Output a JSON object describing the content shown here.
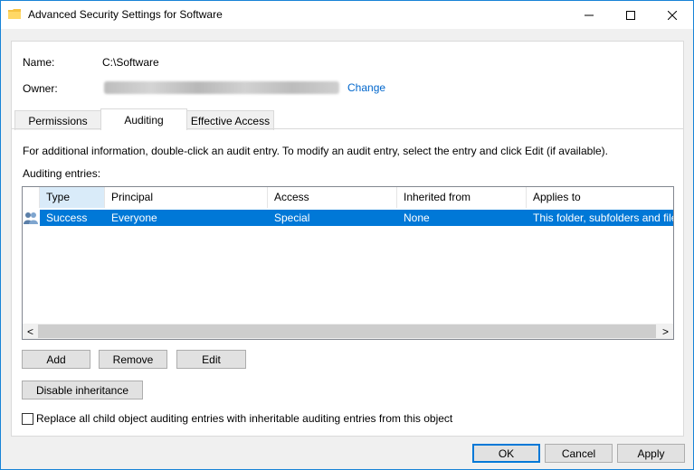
{
  "window": {
    "title": "Advanced Security Settings for Software",
    "icon": "folder-icon",
    "controls": [
      "minimize-icon",
      "maximize-icon",
      "close-icon"
    ]
  },
  "details": {
    "name_label": "Name:",
    "name_value": "C:\\Software",
    "owner_label": "Owner:",
    "change_link": "Change"
  },
  "tabs": [
    {
      "label": "Permissions",
      "active": false
    },
    {
      "label": "Auditing",
      "active": true
    },
    {
      "label": "Effective Access",
      "active": false
    }
  ],
  "auditing": {
    "info_text": "For additional information, double-click an audit entry. To modify an audit entry, select the entry and click Edit (if available).",
    "entries_label": "Auditing entries:",
    "columns": [
      "Type",
      "Principal",
      "Access",
      "Inherited from",
      "Applies to"
    ],
    "rows": [
      {
        "icon": "users-icon",
        "type": "Success",
        "principal": "Everyone",
        "access": "Special",
        "inherited_from": "None",
        "applies_to": "This folder, subfolders and files"
      }
    ],
    "scroll_left": "<",
    "scroll_right": ">"
  },
  "buttons": {
    "add": "Add",
    "remove": "Remove",
    "edit": "Edit",
    "disable_inheritance": "Disable inheritance"
  },
  "replace_checkbox": {
    "label": "Replace all child object auditing entries with inheritable auditing entries from this object",
    "checked": false
  },
  "footer": {
    "ok": "OK",
    "cancel": "Cancel",
    "apply": "Apply"
  },
  "colors": {
    "accent": "#0078d7",
    "link": "#0066cc",
    "selection": "#0078d7",
    "sorted_header": "#d9ebf9"
  }
}
